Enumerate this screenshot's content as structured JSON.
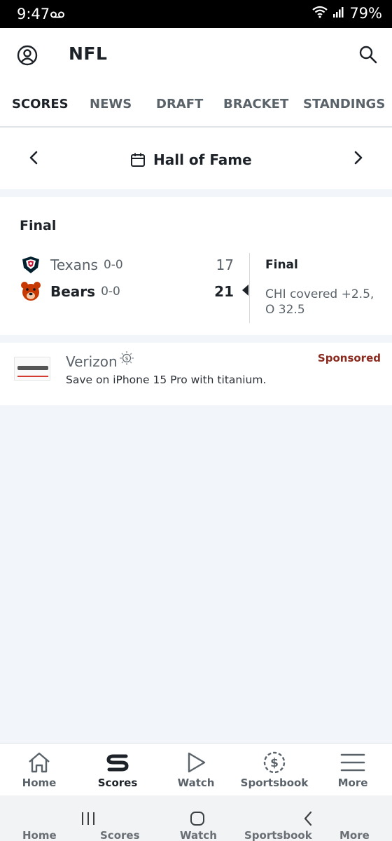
{
  "status_bar": {
    "time": "9:47",
    "battery": "79%"
  },
  "header": {
    "title": "NFL"
  },
  "tabs": [
    {
      "label": "SCORES",
      "active": true
    },
    {
      "label": "NEWS",
      "active": false
    },
    {
      "label": "DRAFT",
      "active": false
    },
    {
      "label": "BRACKET",
      "active": false
    },
    {
      "label": "STANDINGS",
      "active": false
    }
  ],
  "date_nav": {
    "label": "Hall of Fame"
  },
  "game": {
    "status": "Final",
    "teams": [
      {
        "name": "Texans",
        "record": "0-0",
        "score": "17",
        "winner": false
      },
      {
        "name": "Bears",
        "record": "0-0",
        "score": "21",
        "winner": true
      }
    ],
    "result_status": "Final",
    "result_note": "CHI covered +2.5, O 32.5"
  },
  "ad": {
    "brand": "Verizon",
    "sponsored_label": "Sponsored",
    "tagline": "Save on iPhone 15 Pro with titanium."
  },
  "bottom_nav": [
    {
      "label": "Home",
      "icon": "home-icon",
      "active": false
    },
    {
      "label": "Scores",
      "icon": "scores-icon",
      "active": true
    },
    {
      "label": "Watch",
      "icon": "play-icon",
      "active": false
    },
    {
      "label": "Sportsbook",
      "icon": "dollar-icon",
      "active": false
    },
    {
      "label": "More",
      "icon": "menu-icon",
      "active": false
    }
  ],
  "colors": {
    "text_primary": "#1d2228",
    "text_secondary": "#5b636a",
    "page_bg": "#f2f5f9",
    "sponsored": "#8c2a1f",
    "texans_red": "#c8102e",
    "texans_navy": "#03202f",
    "bears_orange": "#c83803",
    "bears_navy": "#0b162a"
  }
}
